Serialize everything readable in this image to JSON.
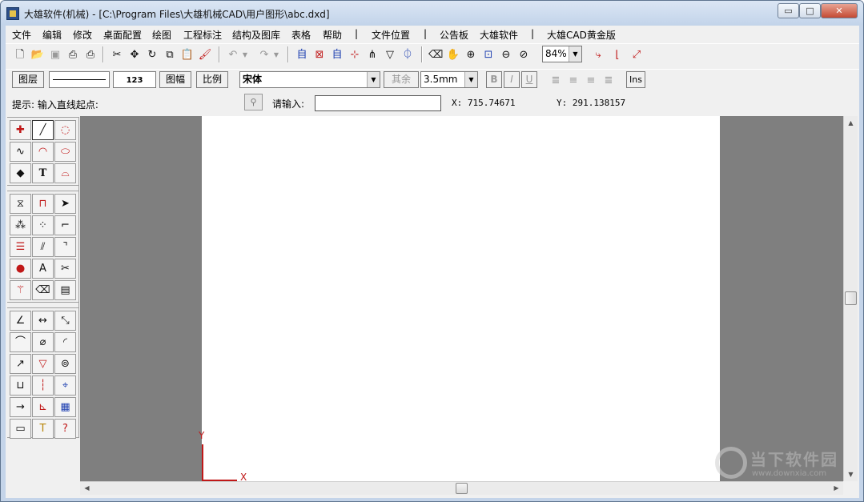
{
  "window": {
    "title": "大雄软件(机械) - [C:\\Program Files\\大雄机械CAD\\用户图形\\abc.dxd]",
    "minimize_glyph": "▭",
    "maximize_glyph": "□",
    "close_glyph": "✕"
  },
  "menu": [
    "文件",
    "编辑",
    "修改",
    "桌面配置",
    "绘图",
    "工程标注",
    "结构及图库",
    "表格",
    "帮助",
    "|",
    "文件位置",
    "|",
    "公告板",
    "大雄软件",
    "|",
    "大雄CAD黄金版"
  ],
  "toolbar1": {
    "zoom_value": "84%"
  },
  "toolbar2": {
    "layer_button": "图层",
    "dim_style_label": "123",
    "sheet_button": "图幅",
    "scale_button": "比例",
    "font_value": "宋体",
    "other_button": "其余",
    "size_value": "3.5mm",
    "bold_label": "B",
    "italic_label": "I",
    "underline_label": "U",
    "ins_button": "Ins"
  },
  "prompt": {
    "hint": "提示:  输入直线起点:",
    "input_label": "请输入:",
    "input_value": "",
    "x_coord": "X:  715.74671",
    "y_coord": "Y:  291.138157"
  },
  "canvas": {
    "axis_y_label": "Y",
    "axis_x_label": "X"
  },
  "watermark": {
    "title": "当下软件园",
    "url": "www.downxia.com"
  },
  "colors": {
    "titlebar": "#c3d4ea",
    "workspace": "#7f7f7f",
    "paper": "#ffffff",
    "axis": "#c01818"
  }
}
